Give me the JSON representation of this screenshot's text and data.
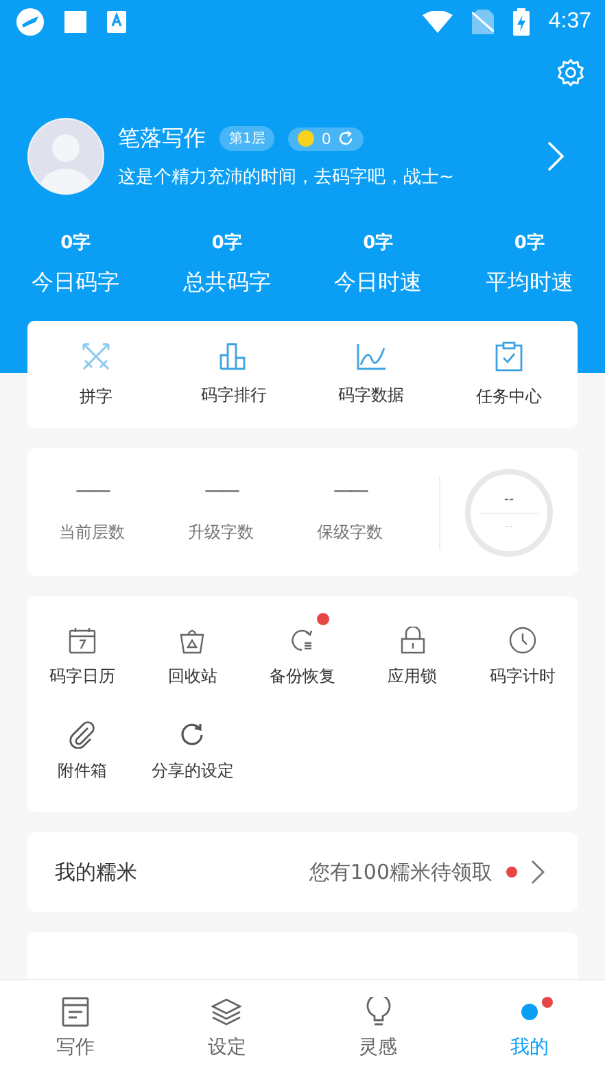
{
  "status_bar": {
    "time": "4:37"
  },
  "profile": {
    "name": "笔落写作",
    "level_badge": "第1层",
    "coins": "0",
    "motto": "这是个精力充沛的时间，去码字吧，战士~"
  },
  "stats": [
    {
      "value": "0字",
      "label": "今日码字"
    },
    {
      "value": "0字",
      "label": "总共码字"
    },
    {
      "value": "0字",
      "label": "今日时速"
    },
    {
      "value": "0字",
      "label": "平均时速"
    }
  ],
  "shortcuts": [
    {
      "label": "拼字"
    },
    {
      "label": "码字排行"
    },
    {
      "label": "码字数据"
    },
    {
      "label": "任务中心"
    }
  ],
  "level_info": {
    "items": [
      {
        "value": "——",
        "label": "当前层数"
      },
      {
        "value": "——",
        "label": "升级字数"
      },
      {
        "value": "——",
        "label": "保级字数"
      }
    ],
    "ring_top": "--",
    "ring_bottom": "--"
  },
  "tools": [
    {
      "label": "码字日历",
      "badge": false
    },
    {
      "label": "回收站",
      "badge": false
    },
    {
      "label": "备份恢复",
      "badge": true
    },
    {
      "label": "应用锁",
      "badge": false
    },
    {
      "label": "码字计时",
      "badge": false
    },
    {
      "label": "附件箱",
      "badge": false
    },
    {
      "label": "分享的设定",
      "badge": false
    }
  ],
  "rice": {
    "title": "我的糯米",
    "note": "您有100糯米待领取",
    "badge": true
  },
  "nav": [
    {
      "label": "写作",
      "selected": false,
      "badge": false
    },
    {
      "label": "设定",
      "selected": false,
      "badge": false
    },
    {
      "label": "灵感",
      "selected": false,
      "badge": false
    },
    {
      "label": "我的",
      "selected": true,
      "badge": true
    }
  ]
}
